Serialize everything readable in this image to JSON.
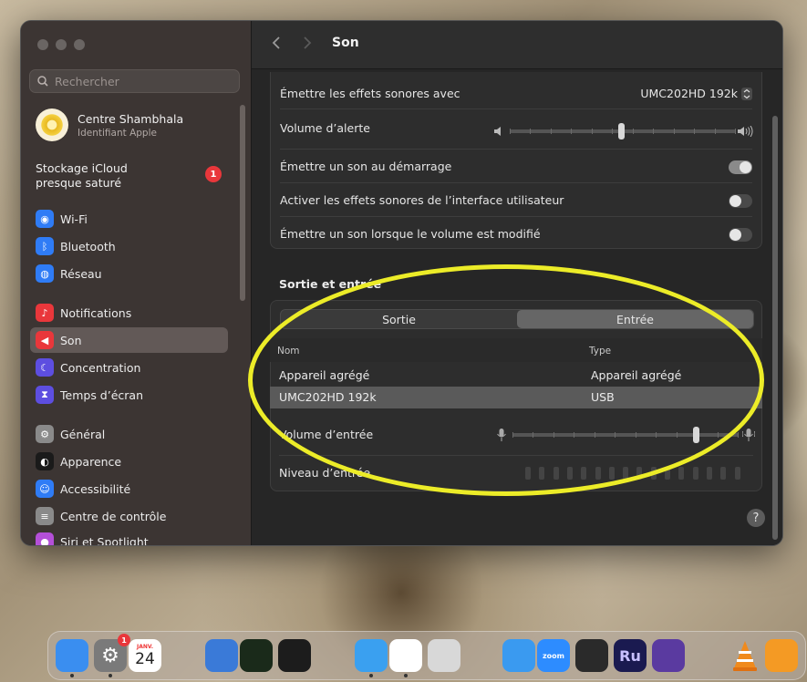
{
  "sidebar": {
    "search_placeholder": "Rechercher",
    "profile_name": "Centre Shambhala",
    "profile_sub": "Identifiant Apple",
    "icloud_line1": "Stockage iCloud",
    "icloud_line2": "presque saturé",
    "icloud_badge": "1",
    "items": [
      {
        "label": "Wi-Fi",
        "color": "#2f7cf6",
        "icon": "wifi-icon"
      },
      {
        "label": "Bluetooth",
        "color": "#2f7cf6",
        "icon": "bluetooth-icon"
      },
      {
        "label": "Réseau",
        "color": "#2f7cf6",
        "icon": "globe-icon"
      },
      {
        "label": "Notifications",
        "color": "#e9373b",
        "icon": "bell-icon"
      },
      {
        "label": "Son",
        "color": "#e9373b",
        "icon": "speaker-icon"
      },
      {
        "label": "Concentration",
        "color": "#5d4ee0",
        "icon": "moon-icon"
      },
      {
        "label": "Temps d’écran",
        "color": "#5d4ee0",
        "icon": "hourglass-icon"
      },
      {
        "label": "Général",
        "color": "#8a8a8a",
        "icon": "gear-icon"
      },
      {
        "label": "Apparence",
        "color": "#1a1a1a",
        "icon": "appearance-icon"
      },
      {
        "label": "Accessibilité",
        "color": "#2f7cf6",
        "icon": "accessibility-icon"
      },
      {
        "label": "Centre de contrôle",
        "color": "#8a8a8a",
        "icon": "control-center-icon"
      },
      {
        "label": "Siri et Spotlight",
        "color": "#b44fd8",
        "icon": "siri-icon"
      }
    ]
  },
  "header": {
    "title": "Son"
  },
  "effects": {
    "play_with_label": "Émettre les effets sonores avec",
    "play_with_value": "UMC202HD 192k",
    "alert_volume_label": "Volume d’alerte",
    "alert_volume_level": 0.49,
    "startup_label": "Émettre un son au démarrage",
    "startup_on": true,
    "ui_effects_label": "Activer les effets sonores de l’interface utilisateur",
    "ui_effects_on": false,
    "volume_feedback_label": "Émettre un son lorsque le volume est modifié",
    "volume_feedback_on": false
  },
  "io": {
    "section_title": "Sortie et entrée",
    "tab_output": "Sortie",
    "tab_input": "Entrée",
    "selected_tab": "Entrée",
    "col_name": "Nom",
    "col_type": "Type",
    "devices": [
      {
        "name": "Appareil agrégé",
        "type": "Appareil agrégé",
        "selected": false
      },
      {
        "name": "UMC202HD 192k",
        "type": "USB",
        "selected": true
      }
    ],
    "input_volume_label": "Volume d’entrée",
    "input_volume_level": 0.81,
    "input_level_label": "Niveau d’entrée",
    "input_level_segments": 16,
    "input_level_value": 0
  },
  "dock": {
    "calendar_month": "JANV.",
    "calendar_day": "24",
    "settings_badge": "1",
    "zoom_label": "zoom",
    "ru_label": "Ru",
    "apps": [
      {
        "name": "finder-icon",
        "color": "#3a8ef0"
      },
      {
        "name": "system-settings-icon",
        "color": "#7a7a7a"
      },
      {
        "name": "calendar-icon",
        "color": "#ffffff"
      },
      {
        "name": "app-icon-4",
        "color": "#3a7ad8"
      },
      {
        "name": "activity-monitor-icon",
        "color": "#1a2a1a"
      },
      {
        "name": "speed-icon",
        "color": "#1c1c1c"
      },
      {
        "name": "safari-icon",
        "color": "#3aa0f0"
      },
      {
        "name": "chrome-icon",
        "color": "#ffffff"
      },
      {
        "name": "preview-icon",
        "color": "#d8d8d8"
      },
      {
        "name": "mail-icon",
        "color": "#3a9af0"
      },
      {
        "name": "zoom-icon",
        "color": "#2d8cff"
      },
      {
        "name": "obs-icon",
        "color": "#2a2a2a"
      },
      {
        "name": "adobe-rush-icon",
        "color": "#1a1a50"
      },
      {
        "name": "imovie-icon",
        "color": "#5a3aa0"
      },
      {
        "name": "vlc-icon",
        "color": "transparent"
      },
      {
        "name": "pages-icon",
        "color": "#f49a24"
      }
    ]
  }
}
